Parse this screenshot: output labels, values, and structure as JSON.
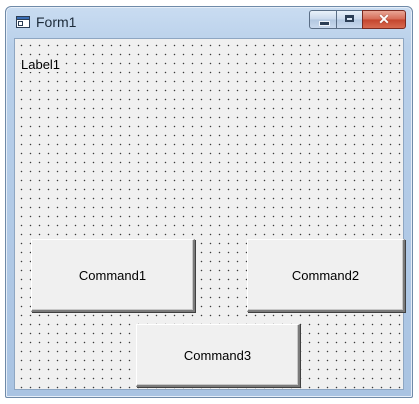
{
  "window": {
    "title": "Form1",
    "controls": [
      "minimize",
      "maximize",
      "close"
    ],
    "close_glyph": "✕"
  },
  "form": {
    "label1": "Label1",
    "command1": "Command1",
    "command2": "Command2",
    "command3": "Command3"
  },
  "icons": {
    "app": "form-window-icon",
    "minimize": "minimize-icon",
    "maximize": "maximize-icon",
    "close": "close-icon"
  },
  "colors": {
    "client_background": "#f0f0f0",
    "grid_dots": "#3b3b3b",
    "close_button": "#c4442d"
  }
}
